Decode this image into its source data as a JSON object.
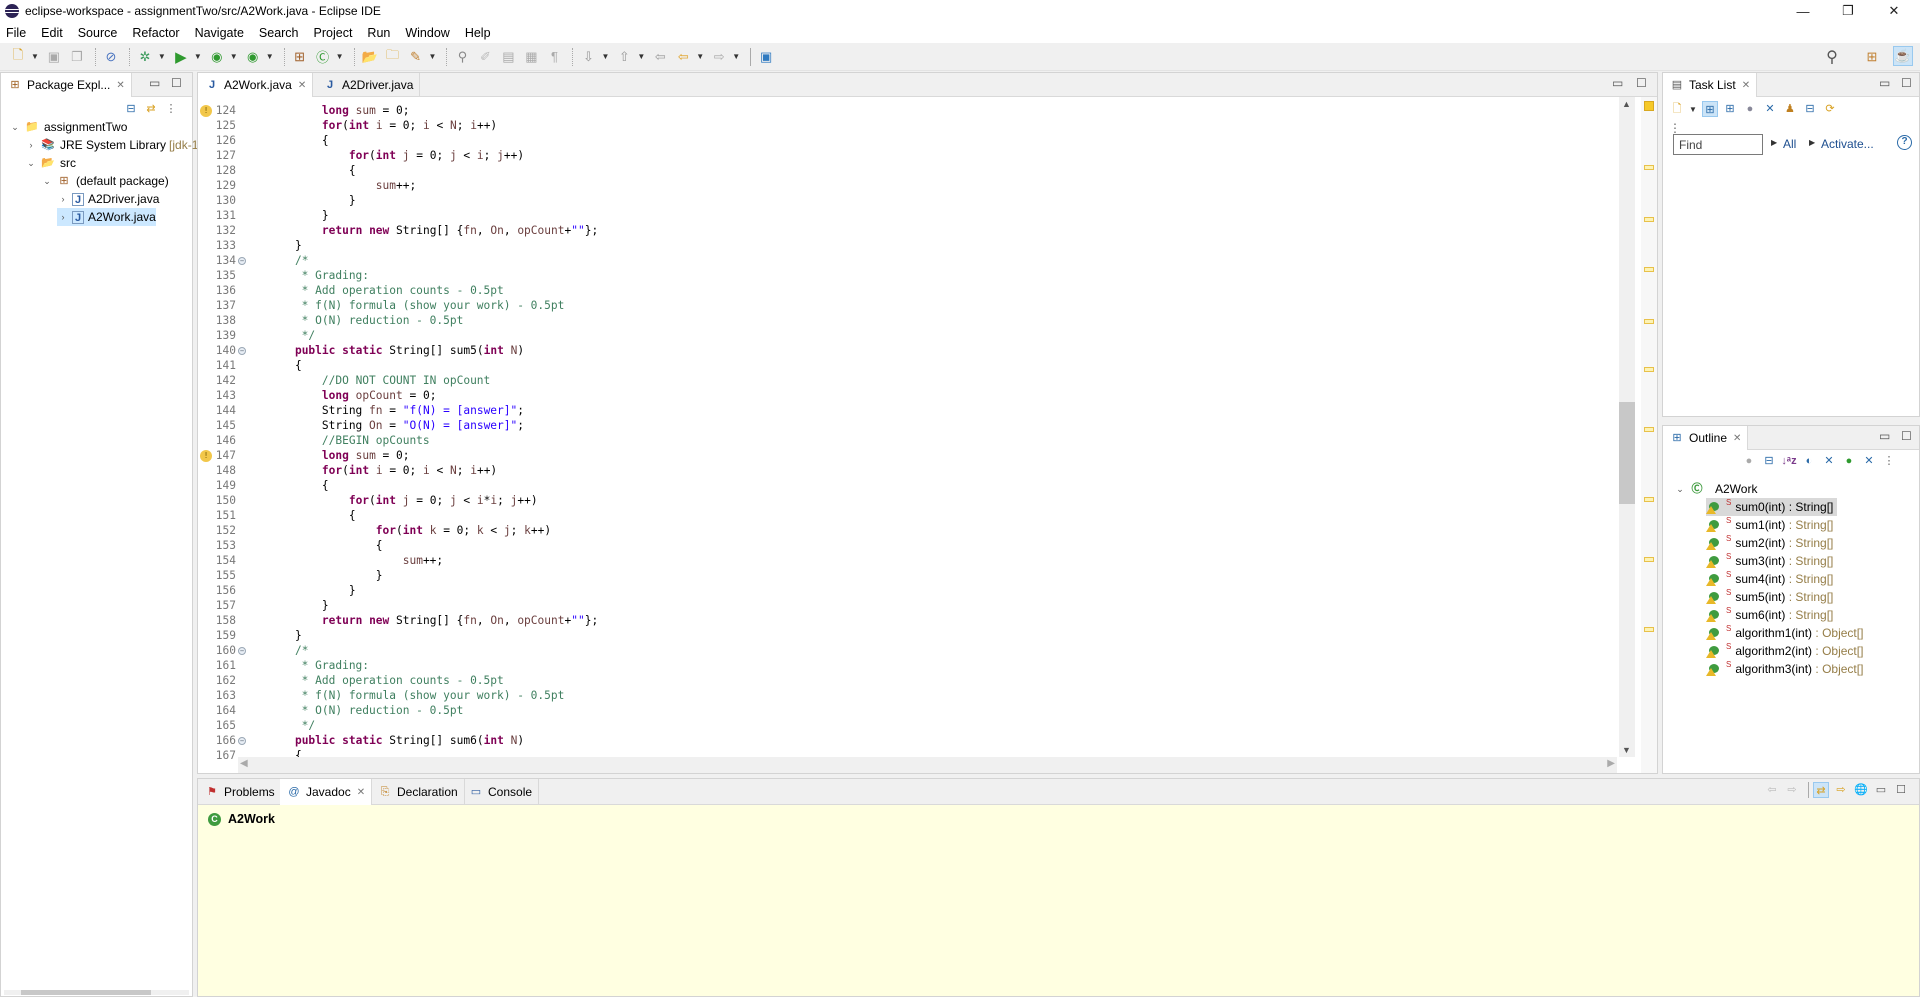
{
  "window": {
    "title": "eclipse-workspace - assignmentTwo/src/A2Work.java - Eclipse IDE",
    "controls": {
      "minimize": "—",
      "restore": "❐",
      "close": "✕"
    }
  },
  "menu": [
    "File",
    "Edit",
    "Source",
    "Refactor",
    "Navigate",
    "Search",
    "Project",
    "Run",
    "Window",
    "Help"
  ],
  "toolbar": {
    "icons": [
      "new-icon",
      "save-icon",
      "save-all-icon",
      "skip-breakpoints-icon",
      "debug-icon",
      "run-icon",
      "coverage-icon",
      "external-tools-icon",
      "new-package-icon",
      "new-class-icon",
      "open-type-icon",
      "open-task-icon",
      "search-tool-icon",
      "toggle-mark-occurrences-icon",
      "toggle-highlight-icon",
      "toggle-block-selection-icon",
      "show-whitespace-icon",
      "next-annotation-icon",
      "previous-annotation-icon",
      "last-edit-location-icon",
      "back-icon",
      "forward-icon",
      "open-perspective-icon"
    ],
    "quick_access_icon": "search-icon"
  },
  "package_explorer": {
    "tab_label": "Package Expl...",
    "tree": [
      {
        "label": "assignmentTwo",
        "level": 0,
        "expanded": true,
        "icon": "project-icon"
      },
      {
        "label": "JRE System Library",
        "suffix": "[jdk-1",
        "level": 1,
        "expanded": false,
        "icon": "library-icon"
      },
      {
        "label": "src",
        "level": 1,
        "expanded": true,
        "icon": "source-folder-icon"
      },
      {
        "label": "(default package)",
        "level": 2,
        "expanded": true,
        "icon": "package-icon"
      },
      {
        "label": "A2Driver.java",
        "level": 3,
        "expanded": false,
        "icon": "java-file-icon"
      },
      {
        "label": "A2Work.java",
        "level": 3,
        "expanded": false,
        "icon": "java-file-icon",
        "selected": true
      }
    ]
  },
  "editor": {
    "tabs": [
      {
        "label": "A2Work.java",
        "active": true,
        "closable": true
      },
      {
        "label": "A2Driver.java",
        "active": false,
        "closable": false
      }
    ],
    "lines": [
      {
        "n": "124",
        "warn": true,
        "html": "        <span class='kw'>long</span> <span class='vr'>sum</span> = 0;"
      },
      {
        "n": "125",
        "html": "        <span class='kw'>for</span>(<span class='kw'>int</span> <span class='vr'>i</span> = 0; <span class='vr'>i</span> &lt; <span class='vr'>N</span>; <span class='vr'>i</span>++)"
      },
      {
        "n": "126",
        "html": "        {"
      },
      {
        "n": "127",
        "html": "            <span class='kw'>for</span>(<span class='kw'>int</span> <span class='vr'>j</span> = 0; <span class='vr'>j</span> &lt; <span class='vr'>i</span>; <span class='vr'>j</span>++)"
      },
      {
        "n": "128",
        "html": "            {"
      },
      {
        "n": "129",
        "html": "                <span class='vr'>sum</span>++;"
      },
      {
        "n": "130",
        "html": "            }"
      },
      {
        "n": "131",
        "html": "        }"
      },
      {
        "n": "132",
        "html": "        <span class='kw'>return</span> <span class='kw'>new</span> String[] {<span class='vr'>fn</span>, <span class='vr'>On</span>, <span class='vr'>opCount</span>+<span class='st'>\"\"</span>};"
      },
      {
        "n": "133",
        "html": "    }"
      },
      {
        "n": "134",
        "fold": true,
        "html": "    <span class='cm'>/*</span>"
      },
      {
        "n": "135",
        "html": "<span class='cm'>     * Grading:</span>"
      },
      {
        "n": "136",
        "html": "<span class='cm'>     * Add operation counts - 0.5pt</span>"
      },
      {
        "n": "137",
        "html": "<span class='cm'>     * f(N) formula (show your work) - 0.5pt</span>"
      },
      {
        "n": "138",
        "html": "<span class='cm'>     * O(N) reduction - 0.5pt</span>"
      },
      {
        "n": "139",
        "html": "<span class='cm'>     */</span>"
      },
      {
        "n": "140",
        "fold": true,
        "html": "    <span class='kw'>public</span> <span class='kw'>static</span> String[] sum5(<span class='kw'>int</span> <span class='vr'>N</span>)"
      },
      {
        "n": "141",
        "html": "    {"
      },
      {
        "n": "142",
        "html": "        <span class='cm'>//DO NOT COUNT IN opCount</span>"
      },
      {
        "n": "143",
        "html": "        <span class='kw'>long</span> <span class='vr'>opCount</span> = 0;"
      },
      {
        "n": "144",
        "html": "        String <span class='vr'>fn</span> = <span class='st'>\"f(N) = [answer]\"</span>;"
      },
      {
        "n": "145",
        "html": "        String <span class='vr'>On</span> = <span class='st'>\"O(N) = [answer]\"</span>;"
      },
      {
        "n": "146",
        "html": "        <span class='cm'>//BEGIN opCounts</span>"
      },
      {
        "n": "147",
        "warn": true,
        "html": "        <span class='kw'>long</span> <span class='vr'>sum</span> = 0;"
      },
      {
        "n": "148",
        "html": "        <span class='kw'>for</span>(<span class='kw'>int</span> <span class='vr'>i</span> = 0; <span class='vr'>i</span> &lt; <span class='vr'>N</span>; <span class='vr'>i</span>++)"
      },
      {
        "n": "149",
        "html": "        {"
      },
      {
        "n": "150",
        "html": "            <span class='kw'>for</span>(<span class='kw'>int</span> <span class='vr'>j</span> = 0; <span class='vr'>j</span> &lt; <span class='vr'>i</span>*<span class='vr'>i</span>; <span class='vr'>j</span>++)"
      },
      {
        "n": "151",
        "html": "            {"
      },
      {
        "n": "152",
        "html": "                <span class='kw'>for</span>(<span class='kw'>int</span> <span class='vr'>k</span> = 0; <span class='vr'>k</span> &lt; <span class='vr'>j</span>; <span class='vr'>k</span>++)"
      },
      {
        "n": "153",
        "html": "                {"
      },
      {
        "n": "154",
        "html": "                    <span class='vr'>sum</span>++;"
      },
      {
        "n": "155",
        "html": "                }"
      },
      {
        "n": "156",
        "html": "            }"
      },
      {
        "n": "157",
        "html": "        }"
      },
      {
        "n": "158",
        "html": "        <span class='kw'>return</span> <span class='kw'>new</span> String[] {<span class='vr'>fn</span>, <span class='vr'>On</span>, <span class='vr'>opCount</span>+<span class='st'>\"\"</span>};"
      },
      {
        "n": "159",
        "html": "    }"
      },
      {
        "n": "160",
        "fold": true,
        "html": "    <span class='cm'>/*</span>"
      },
      {
        "n": "161",
        "html": "<span class='cm'>     * Grading:</span>"
      },
      {
        "n": "162",
        "html": "<span class='cm'>     * Add operation counts - 0.5pt</span>"
      },
      {
        "n": "163",
        "html": "<span class='cm'>     * f(N) formula (show your work) - 0.5pt</span>"
      },
      {
        "n": "164",
        "html": "<span class='cm'>     * O(N) reduction - 0.5pt</span>"
      },
      {
        "n": "165",
        "html": "<span class='cm'>     */</span>"
      },
      {
        "n": "166",
        "fold": true,
        "html": "    <span class='kw'>public</span> <span class='kw'>static</span> String[] sum6(<span class='kw'>int</span> <span class='vr'>N</span>)"
      },
      {
        "n": "167",
        "html": "    {"
      }
    ],
    "vertical_scroll_fraction": 0.58
  },
  "task_list": {
    "tab_label": "Task List",
    "find_placeholder": "Find",
    "all_link": "All",
    "activate_link": "Activate...",
    "help_icon": "?"
  },
  "outline": {
    "tab_label": "Outline",
    "root": "A2Work",
    "members": [
      {
        "name": "sum0(int)",
        "ret": "String[]",
        "selected": true
      },
      {
        "name": "sum1(int)",
        "ret": "String[]"
      },
      {
        "name": "sum2(int)",
        "ret": "String[]"
      },
      {
        "name": "sum3(int)",
        "ret": "String[]"
      },
      {
        "name": "sum4(int)",
        "ret": "String[]"
      },
      {
        "name": "sum5(int)",
        "ret": "String[]"
      },
      {
        "name": "sum6(int)",
        "ret": "String[]"
      },
      {
        "name": "algorithm1(int)",
        "ret": "Object[]"
      },
      {
        "name": "algorithm2(int)",
        "ret": "Object[]"
      },
      {
        "name": "algorithm3(int)",
        "ret": "Object[]"
      }
    ],
    "static_marker": "S",
    "separator": " : "
  },
  "bottom_panel": {
    "tabs": [
      {
        "label": "Problems",
        "active": false,
        "icon": "problems-icon"
      },
      {
        "label": "Javadoc",
        "active": true,
        "icon": "javadoc-icon",
        "closable": true
      },
      {
        "label": "Declaration",
        "active": false,
        "icon": "declaration-icon"
      },
      {
        "label": "Console",
        "active": false,
        "icon": "console-icon"
      }
    ],
    "javadoc_title": "A2Work"
  },
  "colors": {
    "keyword": "#7f0055",
    "comment": "#3f7f5f",
    "string": "#2a00ff",
    "variable": "#6a3e3e",
    "javadoc_bg": "#ffffe1",
    "selection": "#cce8ff"
  }
}
